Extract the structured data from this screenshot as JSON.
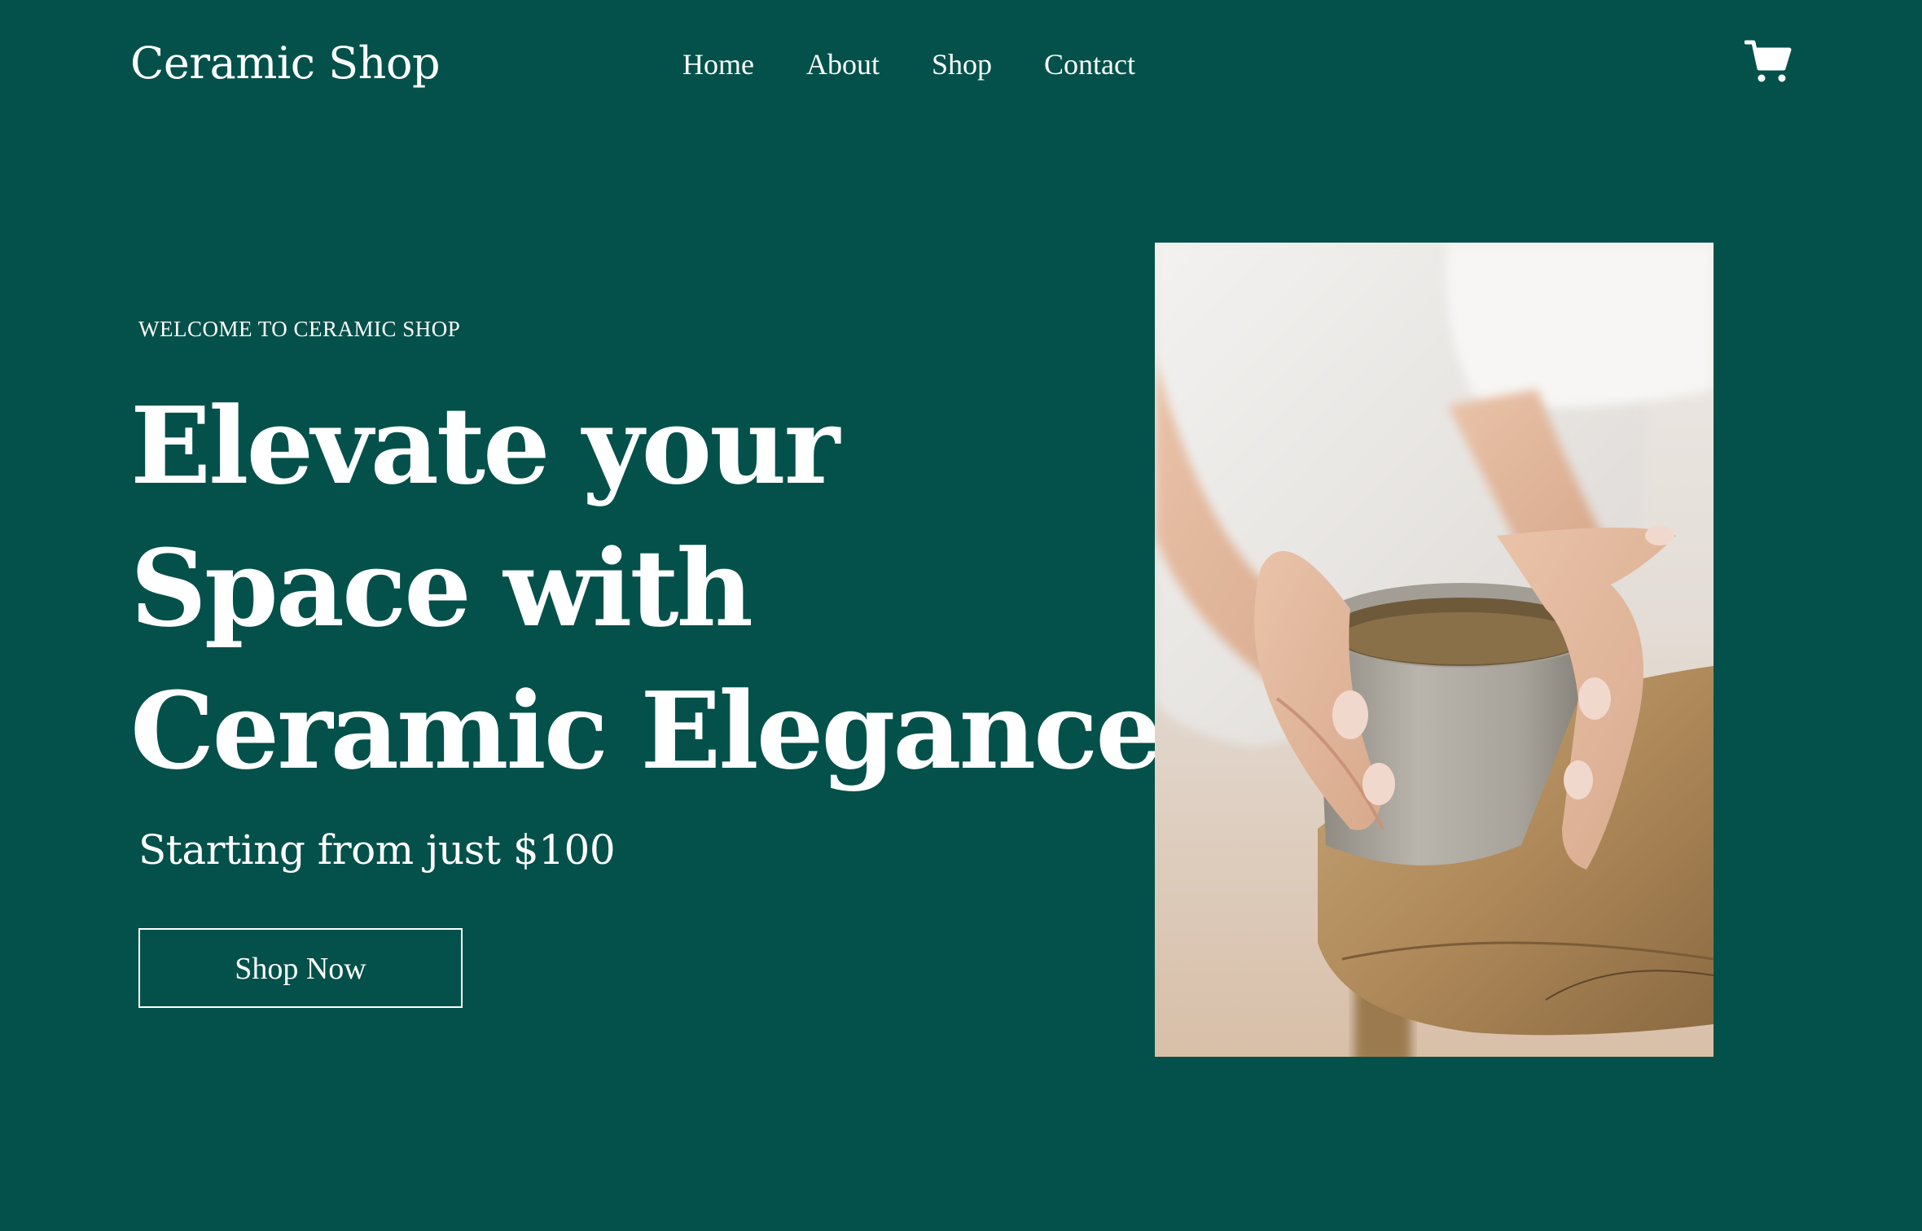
{
  "header": {
    "brand": "Ceramic Shop",
    "nav": [
      {
        "label": "Home"
      },
      {
        "label": "About"
      },
      {
        "label": "Shop"
      },
      {
        "label": "Contact"
      }
    ],
    "cart_icon": "shopping-cart-icon"
  },
  "hero": {
    "eyebrow": "WELCOME TO CERAMIC SHOP",
    "headline_lines": [
      "Elevate your",
      "Space with",
      "Ceramic Elegance"
    ],
    "price_line": "Starting from just $100",
    "cta_label": "Shop Now",
    "image": "photo of hands holding a stoneware ceramic cup on a wooden stool"
  },
  "colors": {
    "background": "#03514a",
    "text": "#ffffff"
  }
}
